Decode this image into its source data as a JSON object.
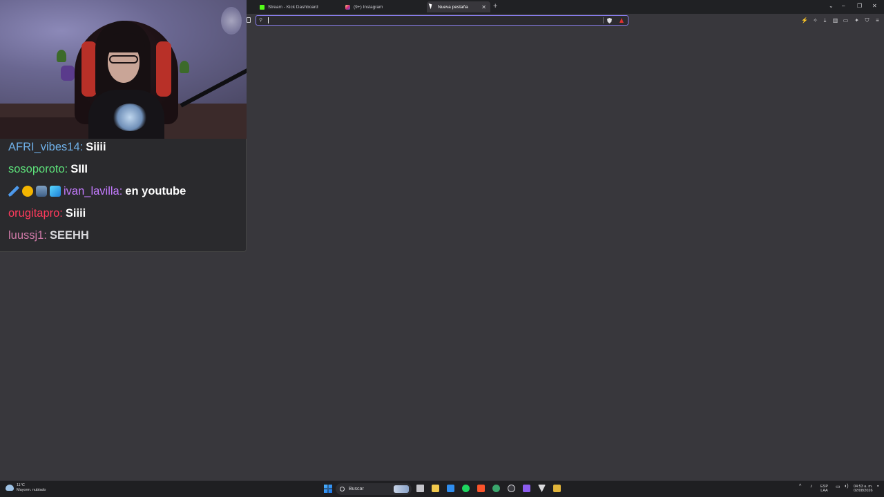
{
  "browser": {
    "tabs": [
      {
        "label": "Stream - Kick Dashboard",
        "favicon": "kick-icon",
        "color": "#53fc18"
      },
      {
        "label": "(9+) Instagram",
        "favicon": "instagram-icon",
        "color": "#e1306c"
      },
      {
        "label": "Nueva pestaña",
        "favicon": "",
        "color": ""
      }
    ],
    "address_bar": {
      "value": "",
      "placeholder": ""
    },
    "accent": "#8a7ef0"
  },
  "chat": {
    "messages": [
      {
        "user": "AFRI_vibes14:",
        "text": "Siiii",
        "color": "#6fb0e8"
      },
      {
        "user": "sosoporoto:",
        "text": "SIII",
        "color": "#5de07a"
      },
      {
        "user": "ivan_lavilla:",
        "text": "en youtube",
        "color": "#c47bff"
      },
      {
        "user": "orugitapro:",
        "text": "Siiii",
        "color": "#ff3a5c"
      },
      {
        "user": "luussj1:",
        "text": "SEEHH",
        "color": "#d07aa8",
        "text_color": "#d9d9dd"
      }
    ]
  },
  "taskbar": {
    "weather_temp": "11°C",
    "weather_desc": "Mayorm. nublado",
    "search_label": "Buscar",
    "lang_top": "ESP",
    "lang_bottom": "LAA",
    "time": "04:53 a. m.",
    "date": "02/08/2026"
  }
}
